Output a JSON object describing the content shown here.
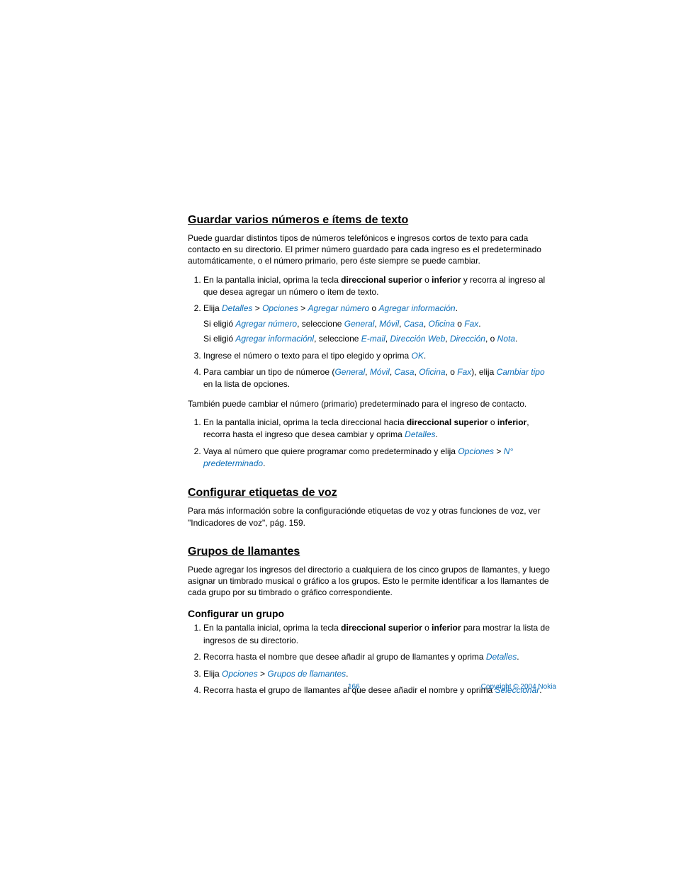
{
  "sections": {
    "s1": {
      "title": "Guardar varios números e ítems de texto",
      "intro": "Puede guardar distintos tipos de números telefónicos e ingresos cortos de texto para cada contacto en su directorio. El primer número guardado para cada ingreso es el predeterminado automáticamente, o el número primario, pero éste siempre se puede cambiar.",
      "li1_a": "En la pantalla inicial, oprima la tecla ",
      "li1_bold1": "direccional superior",
      "li1_o": " o ",
      "li1_bold2": "inferior",
      "li1_b": " y recorra al ingreso al que desea agregar un número o ítem de texto.",
      "li2_a": "Elija ",
      "li2_u1": "Detalles",
      "li2_sep": " > ",
      "li2_u2": "Opciones",
      "li2_u3": "Agregar número",
      "li2_o": " o ",
      "li2_u4": "Agregar información",
      "li2_end": ".",
      "li2s1_a": "Si eligió ",
      "li2s1_u1": "Agregar número",
      "li2s1_b": ", seleccione ",
      "li2s1_u2": "General",
      "li2s1_c": ", ",
      "li2s1_u3": "Móvil",
      "li2s1_u4": "Casa",
      "li2s1_u5": "Oficina",
      "li2s1_o": " o ",
      "li2s1_u6": "Fax",
      "li2s2_a": "Si eligió ",
      "li2s2_u1": "Agregar informaciónl",
      "li2s2_b": ", seleccione ",
      "li2s2_u2": "E-mail",
      "li2s2_u3": "Dirección Web",
      "li2s2_u4": "Dirección",
      "li2s2_o": ", o ",
      "li2s2_u5": "Nota",
      "li3_a": "Ingrese el número o texto para el tipo elegido y oprima ",
      "li3_u1": "OK",
      "li4_a": "Para cambiar un tipo de númeroe (",
      "li4_u1": "General",
      "li4_c": ", ",
      "li4_u2": "Móvil",
      "li4_u3": "Casa",
      "li4_u4": "Oficina",
      "li4_o": ", o ",
      "li4_u5": "Fax",
      "li4_b": "), elija ",
      "li4_u6": "Cambiar tipo",
      "li4_end": " en la lista de opciones.",
      "p2": "También puede cambiar el número (primario) predeterminado para el ingreso de contacto.",
      "l2_1_a": "En la pantalla inicial, oprima la tecla direccional hacia ",
      "l2_1_bold1": "direccional superior",
      "l2_1_o": " o ",
      "l2_1_bold2": "inferior",
      "l2_1_b": ", recorra hasta el ingreso que desea cambiar y oprima ",
      "l2_1_u1": "Detalles",
      "l2_2_a": "Vaya al número que quiere programar como predeterminado y elija ",
      "l2_2_u1": "Opciones",
      "l2_2_sep": " > ",
      "l2_2_u2": "N° predeterminado"
    },
    "s2": {
      "title": "Configurar etiquetas de voz",
      "p": "Para más información sobre la configuraciónde etiquetas de voz y otras funciones de voz, ver \"Indicadores de voz\", pág. 159."
    },
    "s3": {
      "title": "Grupos de llamantes",
      "p": "Puede agregar los ingresos del directorio a cualquiera de los cinco grupos de llamantes, y luego asignar un timbrado musical o gráfico a los grupos. Esto le permite identificar a los llamantes de cada grupo por su timbrado o gráfico correspondiente.",
      "sub_title": "Configurar un grupo",
      "li1_a": "En la pantalla inicial, oprima la tecla ",
      "li1_bold1": "direccional superior",
      "li1_o": " o ",
      "li1_bold2": "inferior",
      "li1_b": " para mostrar la lista de ingresos de su directorio.",
      "li2_a": "Recorra hasta el nombre que desee añadir al grupo de llamantes y oprima ",
      "li2_u1": "Detalles",
      "li3_a": "Elija ",
      "li3_u1": "Opciones",
      "li3_sep": " > ",
      "li3_u2": "Grupos de llamantes",
      "li4_a": "Recorra hasta el grupo de llamantes al que desee añadir el nombre y oprima ",
      "li4_u1": "Seleccionar"
    }
  },
  "footer": {
    "page": "166",
    "copyright": "Copyright © 2004 Nokia"
  }
}
